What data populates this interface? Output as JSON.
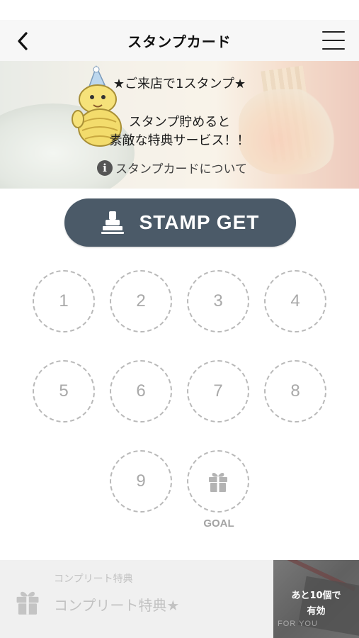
{
  "header": {
    "title": "スタンプカード",
    "back_icon": "chevron-left-icon",
    "menu_icon": "hamburger-menu-icon"
  },
  "banner": {
    "line1": "★ご来店で1スタンプ★",
    "line2": "スタンプ貯めると",
    "line3": "素敵な特典サービス！！",
    "about_link": "スタンプカードについて",
    "about_icon": "info-icon",
    "info_glyph": "i"
  },
  "stamp_button": {
    "label": "STAMP GET",
    "icon": "stamp-icon",
    "color": "#4b5a68"
  },
  "stamps": [
    {
      "label": "1"
    },
    {
      "label": "2"
    },
    {
      "label": "3"
    },
    {
      "label": "4"
    },
    {
      "label": "5"
    },
    {
      "label": "6"
    },
    {
      "label": "7"
    },
    {
      "label": "8"
    },
    {
      "label": "9"
    }
  ],
  "goal": {
    "label": "GOAL",
    "icon": "gift-icon"
  },
  "bottom_bar": {
    "small_label": "コンプリート特典",
    "main_label": "コンプリート特典★",
    "icon": "gift-icon",
    "remaining_line1": "あと10個で",
    "remaining_line2": "有効",
    "image_text": "FOR YOU"
  }
}
